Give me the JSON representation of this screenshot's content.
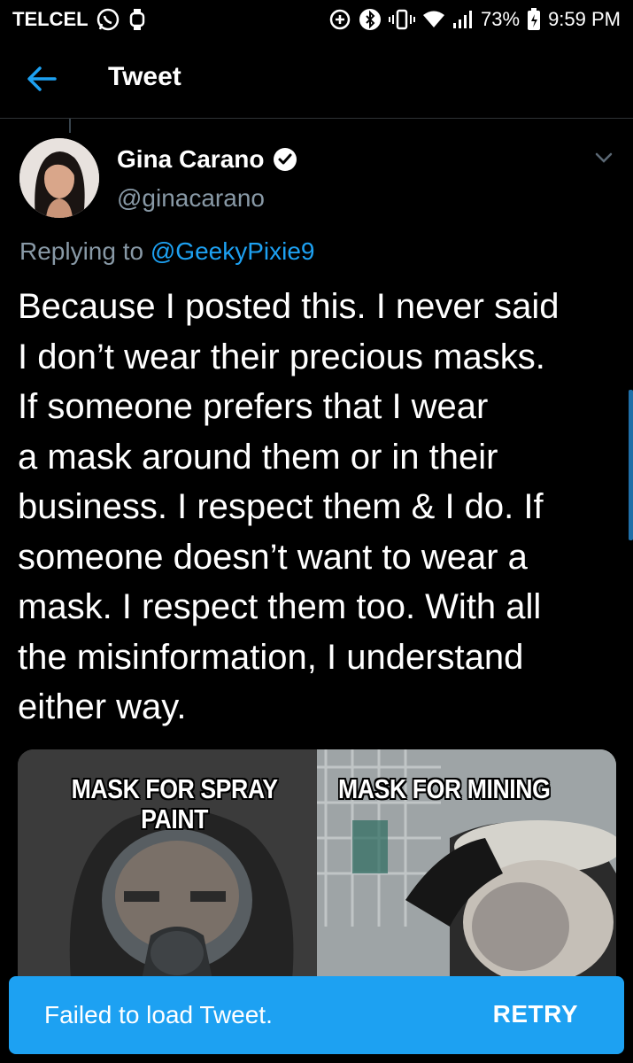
{
  "status_bar": {
    "carrier": "TELCEL",
    "battery_pct": "73%",
    "time": "9:59 PM",
    "icons": [
      "whatsapp-icon",
      "watch-icon",
      "data-saver-icon",
      "bluetooth-icon",
      "vibrate-icon",
      "wifi-icon",
      "signal-icon",
      "battery-icon"
    ]
  },
  "header": {
    "title": "Tweet",
    "back_icon": "arrow-left-icon"
  },
  "tweet": {
    "author_name": "Gina Carano",
    "author_handle": "@ginacarano",
    "verified": true,
    "replying_prefix": "Replying to",
    "replying_to": "@GeekyPixie9",
    "text": "Because I posted this. I never said\nI don’t wear their precious masks.\nIf someone prefers that I wear\na mask around them or in their\nbusiness. I respect them & I do. If\nsomeone doesn’t want to wear a\nmask. I respect them too. With all\nthe misinformation, I understand\neither way.",
    "media": {
      "left_caption": "MASK FOR SPRAY\nPAINT",
      "right_caption": "MASK FOR MINING"
    }
  },
  "snackbar": {
    "message": "Failed to load Tweet.",
    "action": "RETRY"
  },
  "colors": {
    "background": "#000000",
    "accent": "#1da1f2",
    "secondary_text": "#8899a6",
    "divider": "#2f3336"
  }
}
